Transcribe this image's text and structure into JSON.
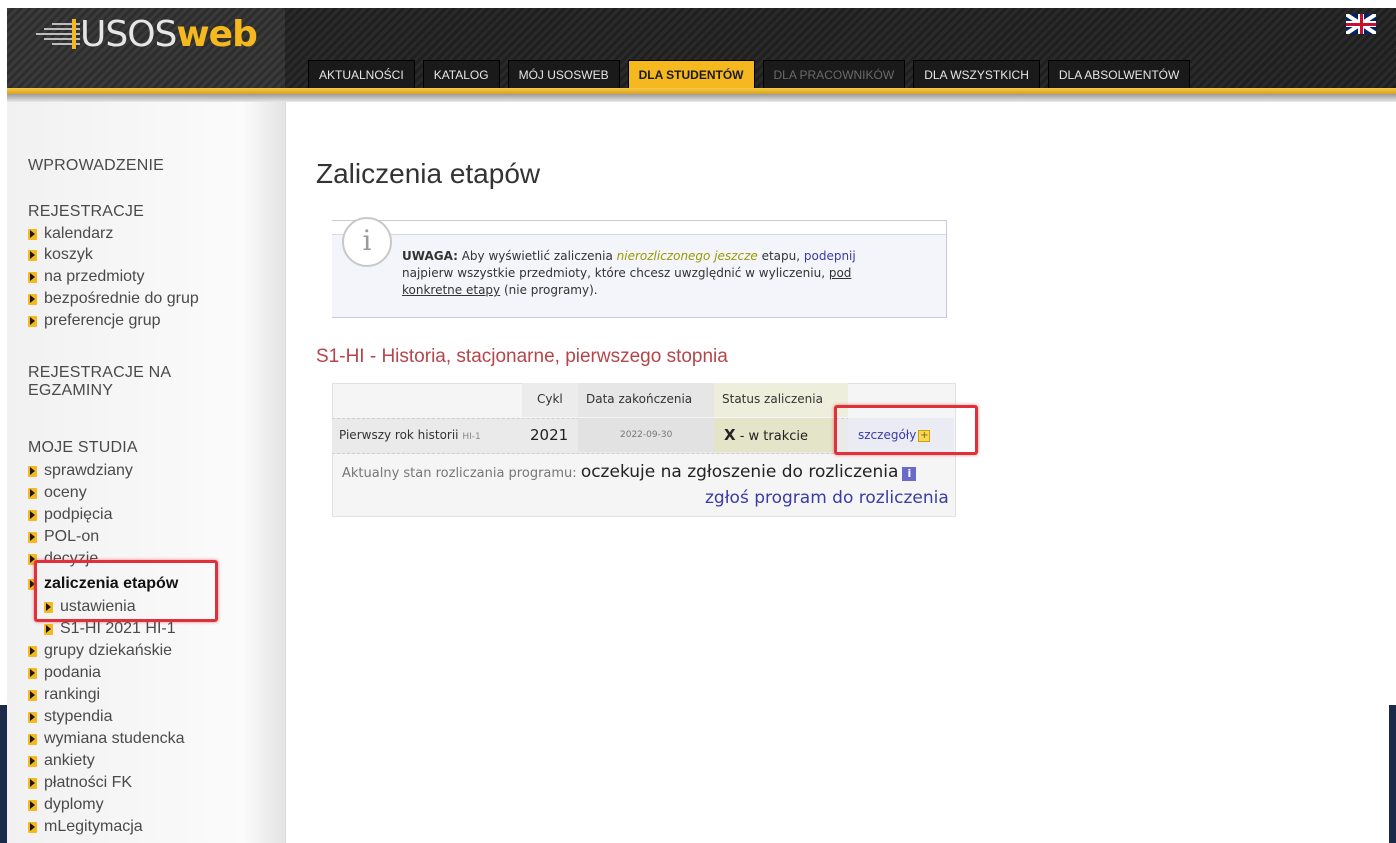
{
  "header": {
    "logo_main": "USOS",
    "logo_accent": "web",
    "language_flag": "uk-flag-icon",
    "tabs": [
      {
        "label": "AKTUALNOŚCI"
      },
      {
        "label": "KATALOG"
      },
      {
        "label": "MÓJ USOSWEB"
      },
      {
        "label": "DLA STUDENTÓW"
      },
      {
        "label": "DLA PRACOWNIKÓW"
      },
      {
        "label": "DLA WSZYSTKICH"
      },
      {
        "label": "DLA ABSOLWENTÓW"
      }
    ],
    "active_tab": "DLA STUDENTÓW"
  },
  "sidebar": {
    "sections": {
      "wprowadzenie": "WPROWADZENIE",
      "rejestracje": "REJESTRACJE",
      "rejestracje_egzaminy_1": "REJESTRACJE NA",
      "rejestracje_egzaminy_2": "EGZAMINY",
      "moje_studia": "MOJE STUDIA"
    },
    "rejestracje_items": [
      "kalendarz",
      "koszyk",
      "na przedmioty",
      "bezpośrednie do grup",
      "preferencje grup"
    ],
    "studia_items": [
      "sprawdziany",
      "oceny",
      "podpięcia",
      "POL-on",
      "decyzje",
      "zaliczenia etapów",
      "ustawienia",
      "S1-HI 2021 HI-1",
      "grupy dziekańskie",
      "podania",
      "rankingi",
      "stypendia",
      "wymiana studencka",
      "ankiety",
      "płatności FK",
      "dyplomy",
      "mLegitymacja"
    ]
  },
  "main": {
    "title": "Zaliczenia etapów",
    "notice": {
      "icon": "info-icon",
      "uwaga": "UWAGA:",
      "part1": " Aby wyświetlić zaliczenia ",
      "emph": "nierozliczonego jeszcze",
      "part2": " etapu, ",
      "link1": "podepnij",
      "line2": "najpierw wszystkie przedmioty, które chcesz uwzględnić w wyliczeniu, ",
      "link2a": "pod",
      "link2b": "konkretne etapy",
      "part3": " (nie programy)."
    },
    "program_title": "S1-HI - Historia, stacjonarne, pierwszego stopnia",
    "table": {
      "headers": [
        "",
        "Cykl",
        "Data zakończenia",
        "Status zaliczenia",
        ""
      ],
      "rows": [
        {
          "etap": "Pierwszy rok historii",
          "etap_code": "HI-1",
          "cykl": "2021",
          "data": "2022-09-30",
          "status_mark": "X",
          "status_text": " - w trakcie",
          "link": "szczegóły"
        }
      ]
    },
    "stan_label": "Aktualny stan rozliczania programu:",
    "stan_value": "oczekuje na zgłoszenie do rozliczenia",
    "zglos_link": "zgłoś program do rozliczenia"
  }
}
